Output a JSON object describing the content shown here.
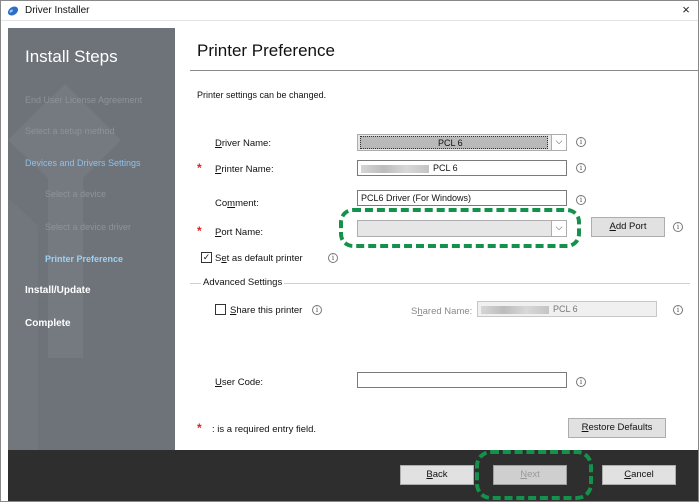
{
  "window": {
    "title": "Driver Installer",
    "close_glyph": "×",
    "icon": "driver-installer-icon"
  },
  "sidebar": {
    "title": "Install Steps",
    "steps": [
      {
        "label": "End User License Agreement",
        "state": "done"
      },
      {
        "label": "Select a setup method",
        "state": "done"
      },
      {
        "label": "Devices and Drivers Settings",
        "state": "active"
      },
      {
        "label": "Select a device",
        "state": "done"
      },
      {
        "label": "Select a device driver",
        "state": "done"
      },
      {
        "label": "Printer Preference",
        "state": "current"
      },
      {
        "label": "Install/Update",
        "state": "pending"
      },
      {
        "label": "Complete",
        "state": "pending"
      }
    ]
  },
  "main": {
    "title": "Printer Preference",
    "subtitle": "Printer settings can be changed.",
    "info_glyph": "i",
    "required_mark": "*",
    "driver_name": {
      "label_u": "D",
      "label_rest": "river Name:",
      "value": "PCL 6"
    },
    "printer_name": {
      "label_u": "P",
      "label_rest": "rinter Name:",
      "value": "PCL 6"
    },
    "comment": {
      "label_pre": "Co",
      "label_u": "m",
      "label_rest": "ment:",
      "value": "PCL6 Driver (For Windows)"
    },
    "port_name": {
      "label_u": "P",
      "label_rest": "ort Name:",
      "value": ""
    },
    "add_port": {
      "label_u": "A",
      "label_rest": "dd Port"
    },
    "set_default": {
      "label_pre": "S",
      "label_u": "e",
      "label_rest": "t as default printer",
      "checked": true
    },
    "advanced": {
      "title": "Advanced Settings",
      "share": {
        "label_u": "S",
        "label_rest": "hare this printer",
        "checked": false
      },
      "shared_name": {
        "label_pre": "S",
        "label_u": "h",
        "label_rest": "ared Name:",
        "value": "PCL 6"
      },
      "user_code": {
        "label_u": "U",
        "label_rest": "ser Code:",
        "value": ""
      }
    },
    "required_note": ": is a required entry field.",
    "restore": {
      "label_u": "R",
      "label_rest": "estore Defaults"
    }
  },
  "footer": {
    "back": {
      "label_u": "B",
      "label_rest": "ack"
    },
    "next": {
      "label_u": "N",
      "label_rest": "ext",
      "enabled": false
    },
    "cancel": {
      "label_u": "C",
      "label_rest": "ancel"
    }
  },
  "colors": {
    "sidebar_bg": "#6d7379",
    "highlight": "#14914a",
    "required": "#dd2222",
    "active_step": "#8fc1ea"
  }
}
